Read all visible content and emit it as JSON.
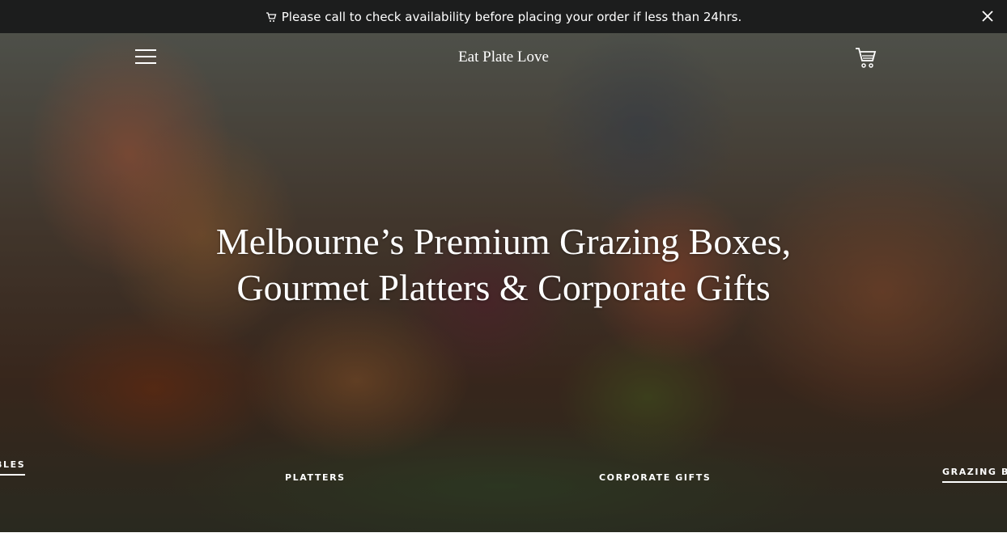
{
  "announcement": {
    "text": "Please call to check availability before placing your order if less than 24hrs.",
    "icon": "cart-icon",
    "close_icon": "close-icon"
  },
  "header": {
    "logo": "Eat Plate Love",
    "menu_icon": "hamburger-menu-icon",
    "cart_icon": "cart-icon"
  },
  "hero": {
    "headline_line1": "Melbourne’s Premium Grazing Boxes,",
    "headline_line2": "Gourmet Platters & Corporate Gifts"
  },
  "slideshow_nav": [
    {
      "label": "BLES",
      "active": true
    },
    {
      "label": "PLATTERS",
      "active": false
    },
    {
      "label": "CORPORATE GIFTS",
      "active": false
    },
    {
      "label": "GRAZING BO",
      "active": true
    }
  ],
  "colors": {
    "announcement_bg": "#1c1d1d",
    "text": "#ffffff"
  }
}
